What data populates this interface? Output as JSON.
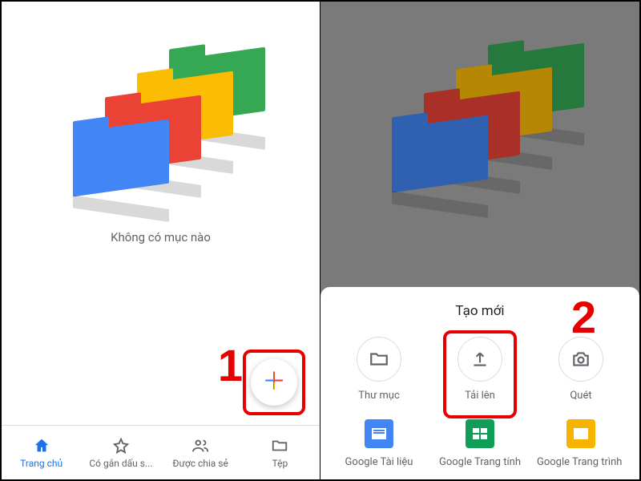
{
  "left": {
    "empty_message": "Không có mục nào",
    "nav": {
      "home": "Trang chủ",
      "starred": "Có gắn dấu s...",
      "shared": "Được chia sẻ",
      "files": "Tệp"
    }
  },
  "right": {
    "sheet_title": "Tạo mới",
    "actions": {
      "folder": "Thư mục",
      "upload": "Tải lên",
      "scan": "Quét",
      "docs": "Google Tài liệu",
      "sheets": "Google Trang tính",
      "slides": "Google Trang trình bày"
    }
  },
  "annotations": {
    "step1": "1",
    "step2": "2"
  },
  "colors": {
    "annotation": "#e60000",
    "google_blue": "#4285F4",
    "google_red": "#EA4335",
    "google_yellow": "#FBBC04",
    "google_green": "#34A853",
    "active_nav": "#1A73E8"
  }
}
